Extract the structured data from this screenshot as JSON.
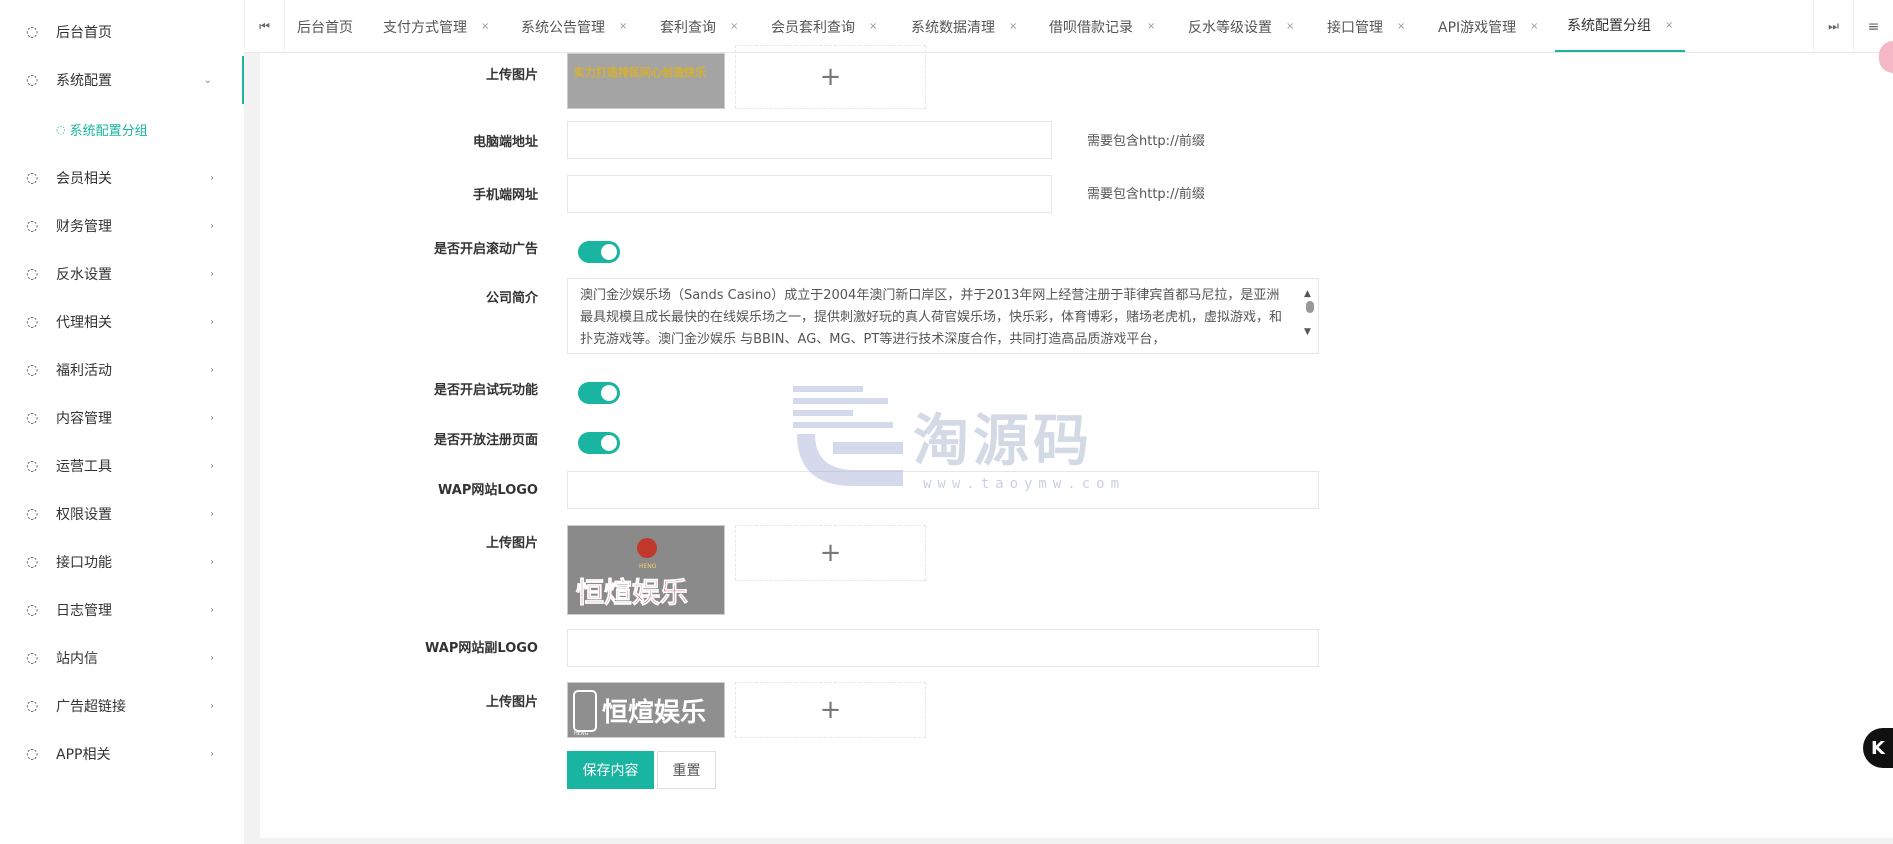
{
  "sidebar": {
    "items": [
      {
        "label": "后台首页",
        "chevron": ""
      },
      {
        "label": "系统配置",
        "chevron": "⌄"
      },
      {
        "label": "会员相关",
        "chevron": "›"
      },
      {
        "label": "财务管理",
        "chevron": "›"
      },
      {
        "label": "反水设置",
        "chevron": "›"
      },
      {
        "label": "代理相关",
        "chevron": "›"
      },
      {
        "label": "福利活动",
        "chevron": "›"
      },
      {
        "label": "内容管理",
        "chevron": "›"
      },
      {
        "label": "运营工具",
        "chevron": "›"
      },
      {
        "label": "权限设置",
        "chevron": "›"
      },
      {
        "label": "接口功能",
        "chevron": "›"
      },
      {
        "label": "日志管理",
        "chevron": "›"
      },
      {
        "label": "站内信",
        "chevron": "›"
      },
      {
        "label": "广告超链接",
        "chevron": "›"
      },
      {
        "label": "APP相关",
        "chevron": "›"
      }
    ],
    "sub_item": "系统配置分组"
  },
  "tabs": [
    {
      "label": "后台首页",
      "close": ""
    },
    {
      "label": "支付方式管理",
      "close": "×"
    },
    {
      "label": "系统公告管理",
      "close": "×"
    },
    {
      "label": "套利查询",
      "close": "×"
    },
    {
      "label": "会员套利查询",
      "close": "×"
    },
    {
      "label": "系统数据清理",
      "close": "×"
    },
    {
      "label": "借呗借款记录",
      "close": "×"
    },
    {
      "label": "反水等级设置",
      "close": "×"
    },
    {
      "label": "接口管理",
      "close": "×"
    },
    {
      "label": "API游戏管理",
      "close": "×"
    },
    {
      "label": "系统配置分组",
      "close": "×"
    }
  ],
  "icons": {
    "nav": "◌",
    "tab_prev": "⏮",
    "tab_next": "⏭",
    "tab_menu": "≡",
    "plus": "+",
    "scroll_up": "▲",
    "scroll_down": "▼",
    "float": "K"
  },
  "form": {
    "upload_label": "上传图片",
    "pc_url_label": "电脑端地址",
    "mobile_url_label": "手机端网址",
    "url_hint": "需要包含http://前缀",
    "scroll_ad_label": "是否开启滚动广告",
    "company_intro_label": "公司简介",
    "company_intro_text": "澳门金沙娱乐场（Sands Casino）成立于2004年澳门新口岸区，并于2013年网上经营注册于菲律宾首都马尼拉，是亚洲最具规模且成长最快的在线娱乐场之一，提供刺激好玩的真人荷官娱乐场，快乐彩，体育博彩，赌场老虎机，虚拟游戏，和扑克游戏等。澳门金沙娱乐 与BBIN、AG、MG、PT等进行技术深度合作，共同打造高品质游戏平台，",
    "trial_label": "是否开启试玩功能",
    "register_label": "是否开放注册页面",
    "wap_logo_label": "WAP网站LOGO",
    "wap_sub_logo_label": "WAP网站副LOGO",
    "banner_text": "实力打造排民间心创造快乐",
    "logo_brand_text": "恒煊娱乐",
    "logo_small_text": "HENG",
    "save_button": "保存内容",
    "reset_button": "重置"
  },
  "watermark": {
    "text": "淘源码",
    "url": "www.taoymw.com"
  },
  "colors": {
    "accent": "#19b5a0"
  }
}
